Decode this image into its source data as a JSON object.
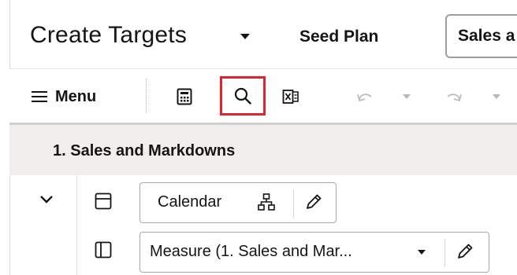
{
  "header": {
    "title": "Create Targets",
    "seed_plan_label": "Seed Plan",
    "selector_value": "Sales a"
  },
  "toolbar": {
    "menu_label": "Menu",
    "icons": [
      "calculate-icon",
      "search-icon",
      "excel-export-icon",
      "undo-icon",
      "redo-icon"
    ]
  },
  "section": {
    "title": "1. Sales and Markdowns"
  },
  "rows": {
    "calendar_label": "Calendar",
    "measure_label": "Measure (1. Sales and Mar..."
  },
  "colors": {
    "highlight": "#e0232c",
    "section_bg": "#f1efed",
    "text": "#161513"
  }
}
